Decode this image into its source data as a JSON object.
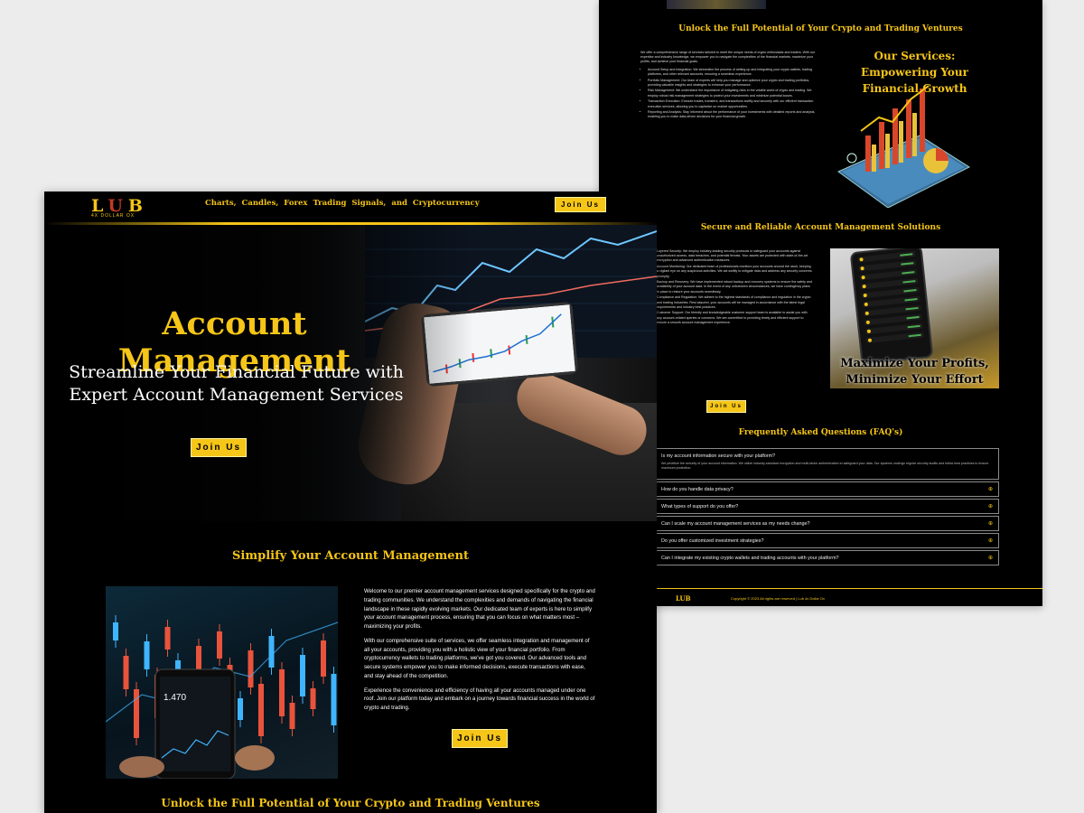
{
  "back": {
    "unlock_title": "Unlock the Full Potential of Your Crypto and Trading Ventures",
    "services_intro": "We offer a comprehensive range of services tailored to meet the unique needs of crypto enthusiasts and traders. With our expertise and industry knowledge, we empower you to navigate the complexities of the financial markets, maximize your profits, and achieve your financial goals.",
    "services_items": [
      "Account Setup and Integration: We streamline the process of setting up and integrating your crypto wallets, trading platforms, and other relevant accounts, ensuring a seamless experience.",
      "Portfolio Management: Our team of experts will help you manage and optimize your crypto and trading portfolios, providing valuable insights and strategies to enhance your performance.",
      "Risk Management: We understand the importance of mitigating risks in the volatile world of crypto and trading. We employ robust risk management strategies to protect your investments and minimize potential losses.",
      "Transaction Execution: Execute trades, transfers, and transactions swiftly and securely with our efficient transaction execution services, allowing you to capitalize on market opportunities.",
      "Reporting and Analysis: Stay informed about the performance of your investments with detailed reports and analysis, enabling you to make data-driven decisions for your financial growth."
    ],
    "services_heading": "Our Services: Empowering Your Financial Growth",
    "secure_title": "Secure and Reliable Account Management Solutions",
    "secure_paragraphs": [
      "Layered Security: We employ industry-leading security protocols to safeguard your accounts against unauthorized access, data breaches, and potential threats. Your assets are protected with state-of-the-art encryption and advanced authentication measures.",
      "Account Monitoring: Our dedicated team of professionals monitors your accounts around the clock, keeping a vigilant eye on any suspicious activities. We act swiftly to mitigate risks and address any security concerns promptly.",
      "Backup and Recovery: We have implemented robust backup and recovery systems to ensure the safety and availability of your account data. In the event of any unforeseen circumstances, we have contingency plans in place to restore your accounts seamlessly.",
      "Compliance and Regulation: We adhere to the highest standards of compliance and regulation in the crypto and trading industries. Rest assured, your accounts will be managed in accordance with the latest legal requirements and industry best practices.",
      "Customer Support: Our friendly and knowledgeable customer support team is available to assist you with any account-related queries or concerns. We are committed to providing timely and efficient support to ensure a smooth account management experience."
    ],
    "phone_caption": "Maximize Your Profits, Minimize Your Effort",
    "join_label": "Join Us",
    "faq_title": "Frequently Asked Questions (FAQ's)",
    "faq": [
      {
        "q": "Is my account information secure with your platform?",
        "a": "We prioritize the security of your account information. We utilize industry-standard encryption and multi-factor authentication to safeguard your data. Our systems undergo regular security audits and follow best practices to ensure maximum protection."
      },
      {
        "q": "How do you handle data privacy?"
      },
      {
        "q": "What types of support do you offer?"
      },
      {
        "q": "Can I scale my account management services as my needs change?"
      },
      {
        "q": "Do you offer customized investment strategies?"
      },
      {
        "q": "Can I integrate my existing crypto wallets and trading accounts with your platform?"
      }
    ],
    "footer_logo": "LUB",
    "footer_copy": "Copyright © 2023 All rights are reserved | Lub 4x Dollar Ox"
  },
  "front": {
    "logo_letters": "LUB",
    "logo_sub": "4X DOLLAR OX",
    "marquee": "Charts, Candles, Forex Trading Signals, and Cryptocurrency",
    "nav_join": "Join Us",
    "hero_title": "Account Management",
    "hero_subtitle": "Streamline Your Financial Future with Expert Account Management Services",
    "hero_join": "Join Us",
    "simplify_title": "Simplify Your Account Management",
    "simplify_paragraphs": [
      "Welcome to our premier account management services designed specifically for the crypto and trading communities. We understand the complexities and demands of navigating the financial landscape in these rapidly evolving markets. Our dedicated team of experts is here to simplify your account management process, ensuring that you can focus on what matters most – maximizing your profits.",
      "With our comprehensive suite of services, we offer seamless integration and management of all your accounts, providing you with a holistic view of your financial portfolio. From cryptocurrency wallets to trading platforms, we've got you covered. Our advanced tools and secure systems empower you to make informed decisions, execute transactions with ease, and stay ahead of the competition.",
      "Experience the convenience and efficiency of having all your accounts managed under one roof. Join our platform today and embark on a journey towards financial success in the world of crypto and trading."
    ],
    "simplify_join": "Join Us",
    "unlock_title": "Unlock the Full Potential of Your Crypto and Trading Ventures",
    "phone_price": "1.470"
  },
  "colors": {
    "accent": "#f5c518",
    "background": "#000000",
    "page_bg": "#ececec"
  }
}
